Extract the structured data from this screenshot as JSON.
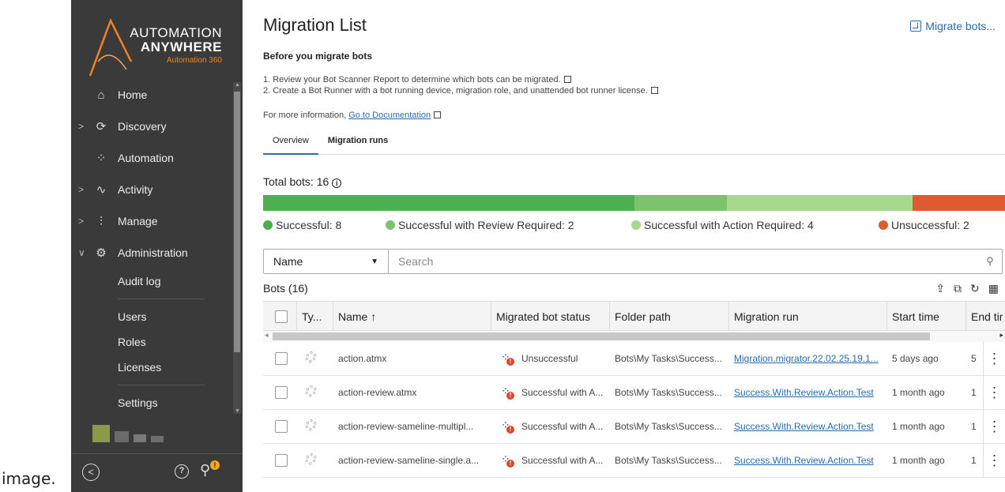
{
  "caption": "image.",
  "brand": {
    "line1": "AUTOMATION",
    "line2": "ANYWHERE",
    "line3": "Automation 360"
  },
  "sidebar": {
    "items": [
      {
        "label": "Home",
        "icon": "home-icon",
        "chevron": ""
      },
      {
        "label": "Discovery",
        "icon": "discovery-icon",
        "chevron": ">"
      },
      {
        "label": "Automation",
        "icon": "automation-icon",
        "chevron": ""
      },
      {
        "label": "Activity",
        "icon": "activity-icon",
        "chevron": ">"
      },
      {
        "label": "Manage",
        "icon": "manage-icon",
        "chevron": ">"
      },
      {
        "label": "Administration",
        "icon": "gear-icon",
        "chevron": "v"
      }
    ],
    "subitems": [
      "Audit log",
      "Users",
      "Roles",
      "Licenses",
      "Settings"
    ],
    "footer": {
      "collapse": "<",
      "help": "?",
      "notif_badge": "!"
    }
  },
  "page": {
    "title": "Migration List",
    "migrate_button": "Migrate bots...",
    "before_heading": "Before you migrate bots",
    "step1": "1. Review your Bot Scanner Report to determine which bots can be migrated.",
    "step2": "2. Create a Bot Runner with a bot running device, migration role, and unattended bot runner license.",
    "more_info_prefix": "For more information, ",
    "more_info_link": "Go to Documentation"
  },
  "tabs": [
    {
      "label": "Overview",
      "active": true
    },
    {
      "label": "Migration runs",
      "active": false
    }
  ],
  "summary": {
    "total_label": "Total bots: 16",
    "segments": [
      {
        "label": "Successful: 8",
        "count": 8,
        "color": "#4caf50"
      },
      {
        "label": "Successful with Review Required: 2",
        "count": 2,
        "color": "#7dc26d"
      },
      {
        "label": "Successful with Action Required: 4",
        "count": 4,
        "color": "#a5d98d"
      },
      {
        "label": "Unsuccessful: 2",
        "count": 2,
        "color": "#e05a30"
      }
    ]
  },
  "filter": {
    "field": "Name",
    "placeholder": "Search"
  },
  "bots": {
    "heading": "Bots (16)",
    "columns": [
      "Ty...",
      "Name ↑",
      "Migrated bot status",
      "Folder path",
      "Migration run",
      "Start time",
      "End tir"
    ],
    "rows": [
      {
        "name": "action.atmx",
        "status": "Unsuccessful",
        "folder": "Bots\\My Tasks\\Success...",
        "run": "Migration.migrator.22.02.25.19.1...",
        "start": "5 days ago",
        "end": "5"
      },
      {
        "name": "action-review.atmx",
        "status": "Successful with A...",
        "folder": "Bots\\My Tasks\\Success...",
        "run": "Success.With.Review.Action.Test",
        "start": "1 month ago",
        "end": "1"
      },
      {
        "name": "action-review-sameline-multipl...",
        "status": "Successful with A...",
        "folder": "Bots\\My Tasks\\Success...",
        "run": "Success.With.Review.Action.Test",
        "start": "1 month ago",
        "end": "1"
      },
      {
        "name": "action-review-sameline-single.a...",
        "status": "Successful with A...",
        "folder": "Bots\\My Tasks\\Success...",
        "run": "Success.With.Review.Action.Test",
        "start": "1 month ago",
        "end": "1"
      }
    ]
  }
}
